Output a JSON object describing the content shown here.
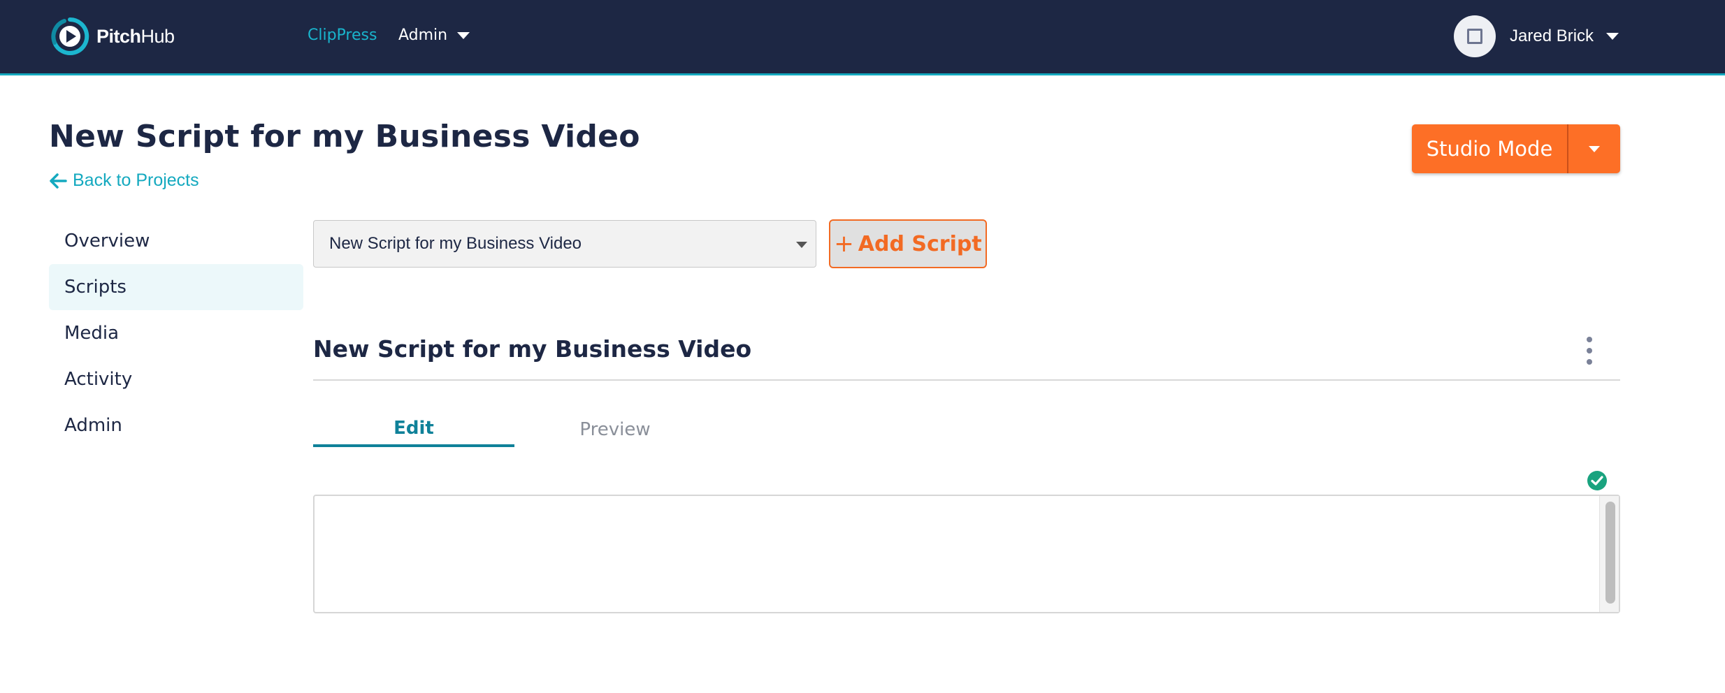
{
  "brand": {
    "name_bold": "Pitch",
    "name_light": "Hub"
  },
  "nav": {
    "primary": "ClipPress",
    "admin": "Admin"
  },
  "user": {
    "name": "Jared Brick"
  },
  "page": {
    "title": "New Script for my Business Video",
    "back_link": "Back to Projects"
  },
  "studio_button": {
    "label": "Studio Mode"
  },
  "sidebar": {
    "items": [
      {
        "label": "Overview"
      },
      {
        "label": "Scripts"
      },
      {
        "label": "Media"
      },
      {
        "label": "Activity"
      },
      {
        "label": "Admin"
      }
    ]
  },
  "script_select": {
    "value": "New Script for my Business Video"
  },
  "add_script": {
    "label": "Add Script"
  },
  "script": {
    "title": "New Script for my Business Video"
  },
  "tabs": [
    {
      "label": "Edit"
    },
    {
      "label": "Preview"
    }
  ],
  "colors": {
    "nav_bg": "#1d2744",
    "accent_teal": "#14a9bf",
    "accent_orange": "#fd6f26",
    "success": "#1aa37f"
  }
}
